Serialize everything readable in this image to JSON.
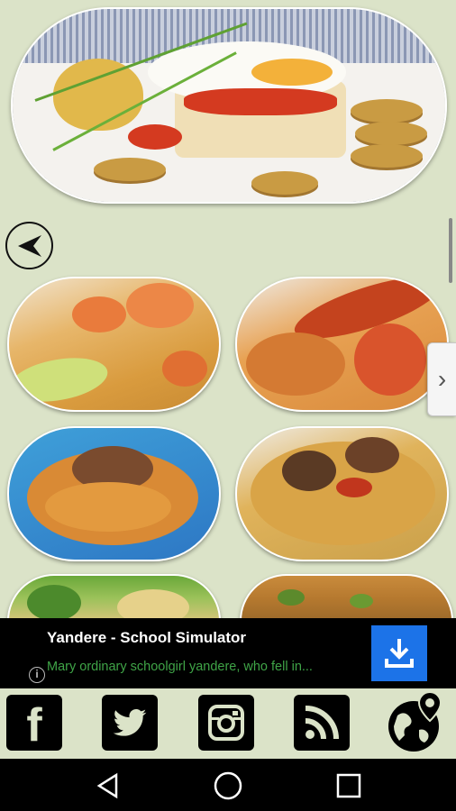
{
  "hero": {
    "image": "fried-egg-rice-hero-photo"
  },
  "nav": {
    "back_icon": "back-arrow-icon",
    "next_icon": "chevron-right-icon",
    "next_label": "›"
  },
  "gallery": {
    "items": [
      {
        "image": "shrimp-rice-photo"
      },
      {
        "image": "lobster-rice-photo"
      },
      {
        "image": "meat-rice-blue-plate-photo"
      },
      {
        "image": "paella-meat-photo"
      },
      {
        "image": "green-vegetable-rice-photo"
      },
      {
        "image": "peas-rice-photo"
      }
    ]
  },
  "ad": {
    "title": "Yandere - School Simulator",
    "description": "Mary ordinary schoolgirl yandere, who fell in...",
    "info_label": "i",
    "download_icon": "download-icon",
    "accent_color": "#1c73e8",
    "description_color": "#3fa447"
  },
  "social": {
    "buttons": [
      {
        "icon": "facebook-icon",
        "label": "f"
      },
      {
        "icon": "twitter-icon"
      },
      {
        "icon": "instagram-icon"
      },
      {
        "icon": "rss-icon"
      },
      {
        "icon": "globe-location-icon"
      }
    ]
  },
  "system_nav": {
    "back": "back-triangle-icon",
    "home": "home-circle-icon",
    "recents": "recents-square-icon"
  },
  "colors": {
    "background": "#dbe3c8",
    "ad_background": "#000000",
    "nav_background": "#000000"
  }
}
